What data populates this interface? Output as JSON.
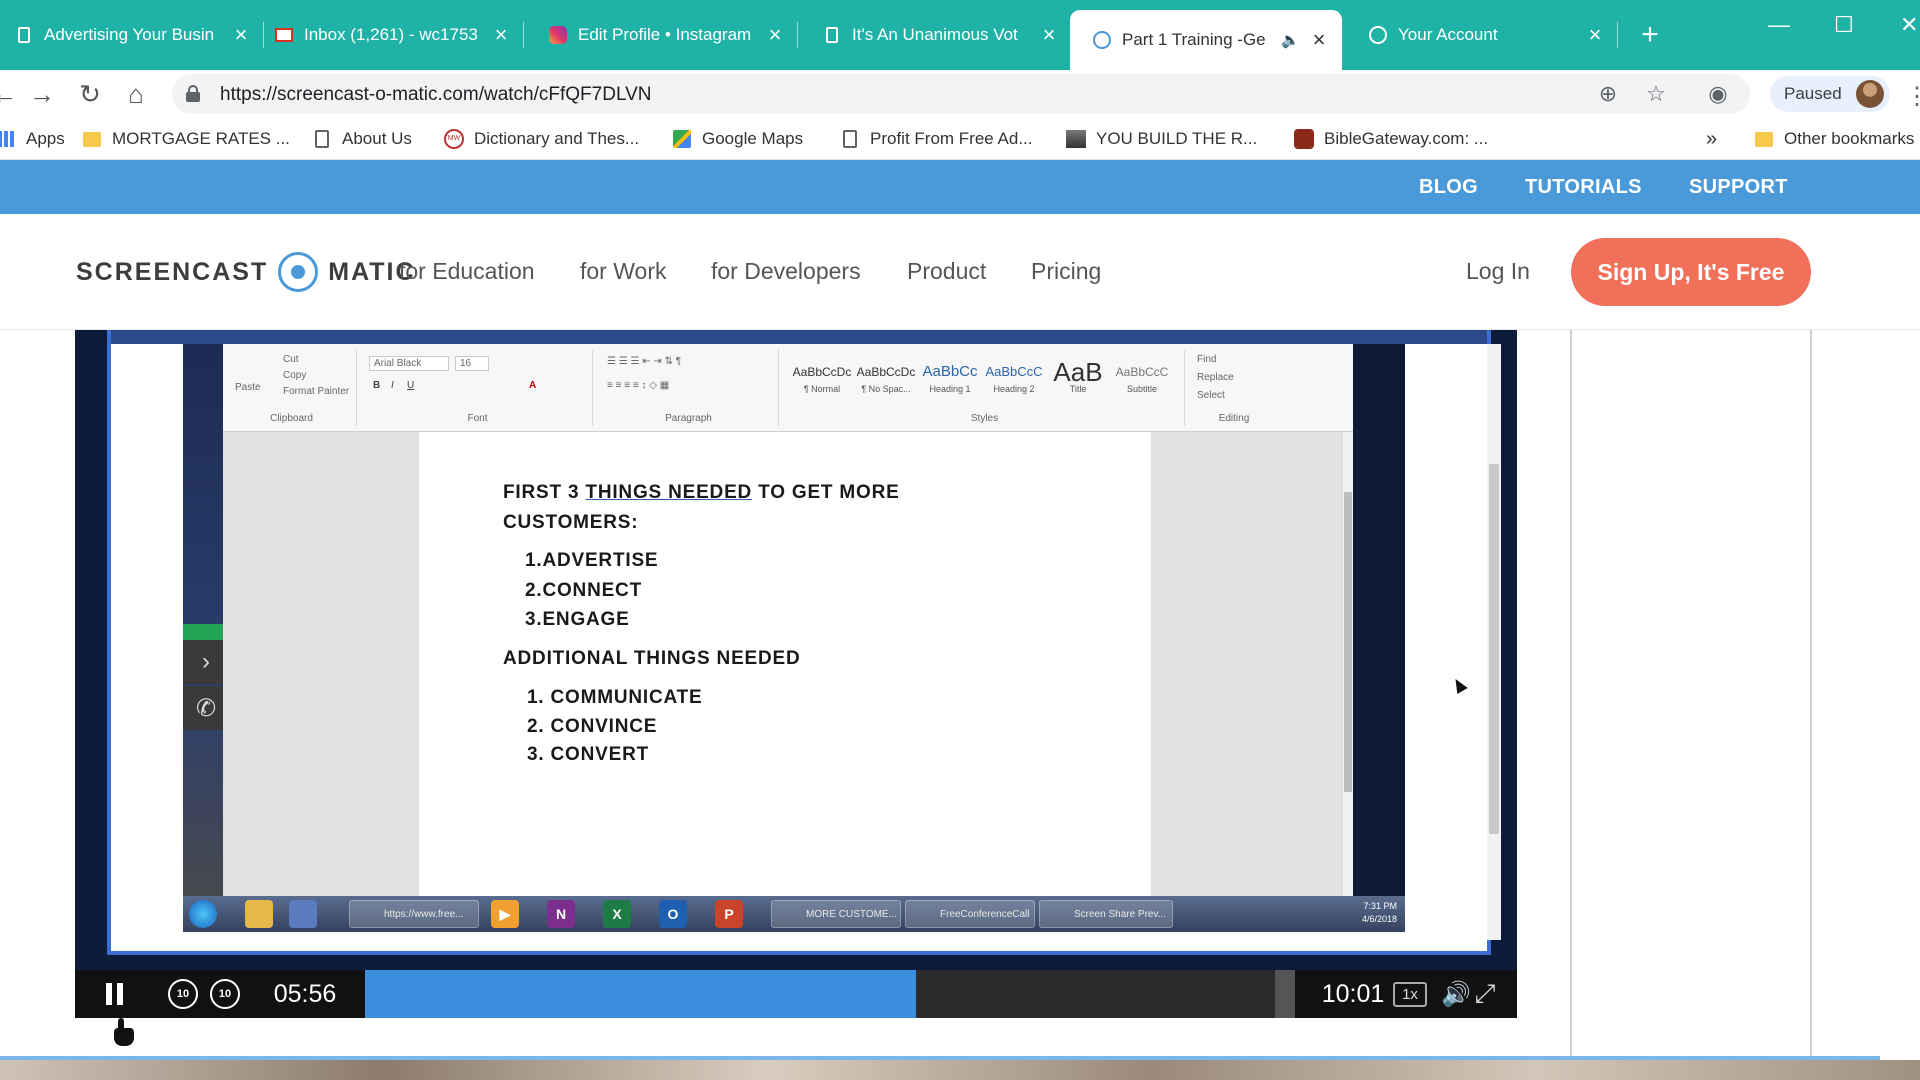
{
  "browser": {
    "tabs": [
      {
        "title": "Advertising Your Busin",
        "close": "×"
      },
      {
        "title": "Inbox (1,261) - wc1753",
        "close": "×"
      },
      {
        "title": "Edit Profile • Instagram",
        "close": "×"
      },
      {
        "title": "It's An Unanimous Vot",
        "close": "×"
      },
      {
        "title": "Part 1 Training -Ge",
        "close": "×",
        "active": true,
        "audio": "🔈"
      },
      {
        "title": "Your Account",
        "close": "×"
      }
    ],
    "new_tab": "+",
    "url": "https://screencast-o-matic.com/watch/cFfQF7DLVN",
    "profile_status": "Paused",
    "bookmarks": [
      {
        "label": "Apps",
        "icon": "apps-icon"
      },
      {
        "label": "MORTGAGE RATES ...",
        "icon": "folder-icon"
      },
      {
        "label": "About Us",
        "icon": "page-icon"
      },
      {
        "label": "Dictionary and Thes...",
        "icon": "dictionary-icon"
      },
      {
        "label": "Google Maps",
        "icon": "maps-icon"
      },
      {
        "label": "Profit From Free Ad...",
        "icon": "page-icon"
      },
      {
        "label": "YOU  BUILD  THE  R...",
        "icon": "image-icon"
      },
      {
        "label": "BibleGateway.com: ...",
        "icon": "biblegateway-icon"
      }
    ],
    "more_bookmarks": "»",
    "other_bookmarks": "Other bookmarks"
  },
  "site": {
    "top_links": [
      "BLOG",
      "TUTORIALS",
      "SUPPORT"
    ],
    "logo_left": "SCREENCAST",
    "logo_right": "MATIC",
    "nav": [
      "for Education",
      "for Work",
      "for Developers",
      "Product",
      "Pricing"
    ],
    "login": "Log In",
    "signup": "Sign Up, It's Free",
    "colors": {
      "top_bar": "#4a9ada",
      "signup": "#f0705a",
      "tab_strip": "#1fb3a8"
    }
  },
  "video": {
    "current_time": "05:56",
    "duration": "10:01",
    "progress_fraction": 0.593,
    "speed": "1x",
    "skip_back": "10",
    "skip_forward": "10",
    "word_ribbon": {
      "clipboard": {
        "paste": "Paste",
        "cut": "Cut",
        "copy": "Copy",
        "format_painter": "Format Painter",
        "label": "Clipboard"
      },
      "font": {
        "name": "Arial Black",
        "size": "16",
        "label": "Font"
      },
      "paragraph_label": "Paragraph",
      "styles": [
        {
          "sample": "AaBbCcDc",
          "name": "¶ Normal"
        },
        {
          "sample": "AaBbCcDc",
          "name": "¶ No Spac..."
        },
        {
          "sample": "AaBbCc",
          "name": "Heading 1"
        },
        {
          "sample": "AaBbCcC",
          "name": "Heading 2"
        },
        {
          "sample": "AaB",
          "name": "Title"
        },
        {
          "sample": "AaBbCcC",
          "name": "Subtitle"
        }
      ],
      "styles_label": "Styles",
      "editing": {
        "find": "Find",
        "replace": "Replace",
        "select": "Select",
        "label": "Editing"
      }
    },
    "document": {
      "heading_pre": "FIRST 3 ",
      "heading_underlined": "THINGS  NEEDED",
      "heading_post": " TO GET MORE",
      "heading_line2": "CUSTOMERS:",
      "list1": [
        "1.ADVERTISE",
        "2.CONNECT",
        "3.ENGAGE"
      ],
      "subheading": "ADDITIONAL THINGS NEEDED",
      "list2": [
        "1.  COMMUNICATE",
        "2.  CONVINCE",
        "3.  CONVERT"
      ]
    },
    "taskbar": {
      "task_chrome": "https://www.free...",
      "task_word": "MORE CUSTOME...",
      "task_conf": "FreeConferenceCall",
      "task_share": "Screen Share Prev...",
      "clock_time": "7:31 PM",
      "clock_date": "4/6/2018"
    }
  }
}
